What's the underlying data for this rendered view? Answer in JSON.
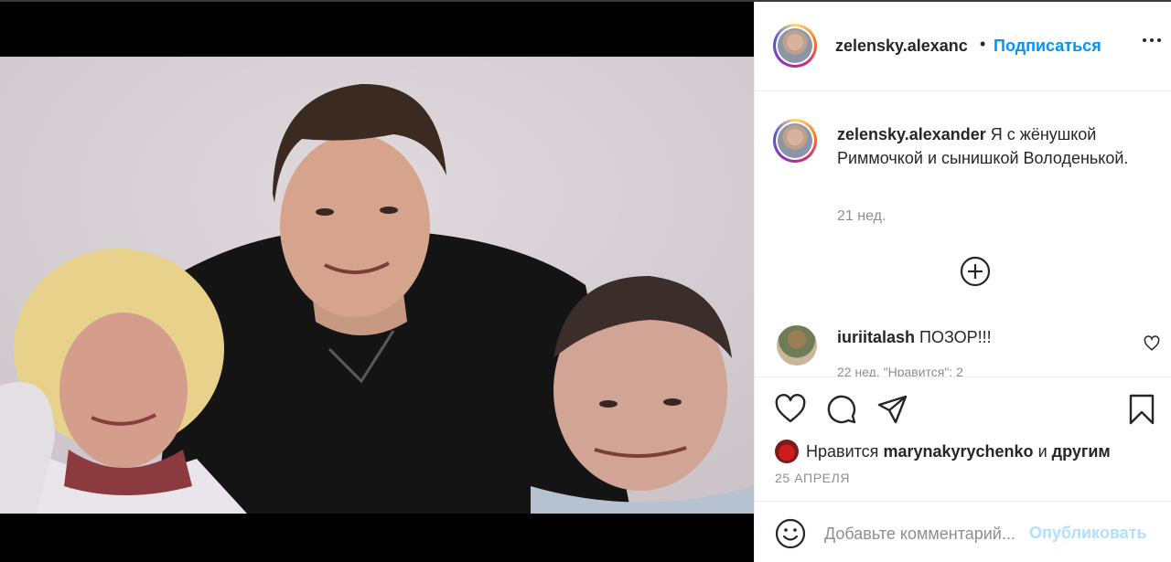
{
  "post": {
    "author": "zelensky.alexander",
    "header_username": "zelensky.alexanс",
    "follow_label": "Подписаться",
    "caption": "Я с жёнушкой Риммочкой и сынишкой Володенькой.",
    "caption_time": "21 нед.",
    "date": "25 АПРЕЛЯ"
  },
  "comments": [
    {
      "username": "iuriitalash",
      "text": "ПОЗОР!!!",
      "meta": "22 нед.   \"Нравится\": 2"
    }
  ],
  "likes": {
    "prefix": "Нравится",
    "user": "marynakyrychenko",
    "connector": "и",
    "suffix": "другим"
  },
  "composer": {
    "placeholder": "Добавьте комментарий...",
    "publish_label": "Опубликовать"
  },
  "icons": {
    "more": "more-dots-icon",
    "load_more": "plus-circle-icon",
    "like": "heart-icon",
    "comment": "comment-bubble-icon",
    "share": "paper-plane-icon",
    "save": "bookmark-icon",
    "emoji": "smiley-icon"
  },
  "colors": {
    "link_blue": "#0095f6",
    "publish_disabled": "#b2dffc",
    "muted": "#8e8e8e"
  }
}
